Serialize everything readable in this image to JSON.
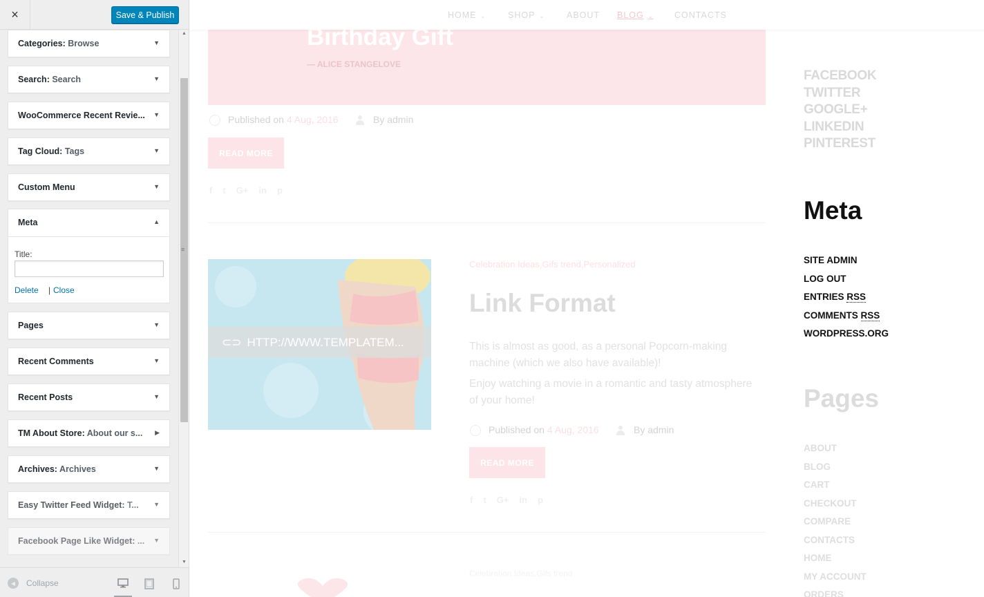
{
  "header": {
    "close_icon": "×",
    "publish_label": "Save & Publish"
  },
  "widgets": [
    {
      "title": "Categories:",
      "sub": " Browse"
    },
    {
      "title": "Search:",
      "sub": " Search"
    },
    {
      "title": "WooCommerce Recent Revie...",
      "sub": ""
    },
    {
      "title": "Tag Cloud:",
      "sub": " Tags"
    },
    {
      "title": "Custom Menu",
      "sub": ""
    },
    {
      "title": "Pages",
      "sub": ""
    },
    {
      "title": "Recent Comments",
      "sub": ""
    },
    {
      "title": "Recent Posts",
      "sub": ""
    },
    {
      "title": "TM About Store:",
      "sub": " About our s..."
    },
    {
      "title": "Archives:",
      "sub": " Archives"
    },
    {
      "title": "Easy Twitter Feed Widget:",
      "sub": " T..."
    },
    {
      "title": "Facebook Page Like Widget:",
      "sub": " ..."
    }
  ],
  "meta_widget": {
    "title": "Meta",
    "field_label": "Title:",
    "field_value": "",
    "delete_label": "Delete",
    "separator": "|",
    "close_label": "Close"
  },
  "footer": {
    "collapse_label": "Collapse"
  },
  "nav": {
    "items": [
      {
        "label": "HOME",
        "has_sub": true
      },
      {
        "label": "SHOP",
        "has_sub": true
      },
      {
        "label": "ABOUT",
        "has_sub": false
      },
      {
        "label": "BLOG",
        "has_sub": true
      },
      {
        "label": "CONTACTS",
        "has_sub": false
      }
    ],
    "active": "BLOG"
  },
  "post1": {
    "quote_title": "Birthday Gift",
    "quote_author": "— ALICE STANGELOVE",
    "published_prefix": "Published on ",
    "date": "4 Aug, 2016",
    "by": "By admin",
    "read_more": "READ MORE",
    "social": [
      "f",
      "t",
      "G+",
      "in",
      "p"
    ]
  },
  "post2": {
    "categories": "Celebration Ideas,Gifs trend,Personalized",
    "link_text": "HTTP://WWW.TEMPLATEM...",
    "title": "Link Format",
    "p1": "This is almost as good, as a personal Popcorn-making machine (which we also have available)!",
    "p2": "Enjoy watching a movie in a romantic and tasty atmosphere of your home!",
    "published_prefix": "Published on ",
    "date": "4 Aug, 2016",
    "by": "By admin",
    "read_more": "READ MORE",
    "social": [
      "f",
      "t",
      "G+",
      "in",
      "p"
    ]
  },
  "post3": {
    "categories": "Celebration Ideas,Gifs trend"
  },
  "right": {
    "social_links": [
      "FACEBOOK",
      "TWITTER",
      "GOOGLE+",
      "LINKEDIN",
      "PINTEREST"
    ],
    "meta_heading": "Meta",
    "meta_links": [
      {
        "text": "SITE ADMIN",
        "abbr": ""
      },
      {
        "text": "LOG OUT",
        "abbr": ""
      },
      {
        "text": "ENTRIES ",
        "abbr": "RSS"
      },
      {
        "text": "COMMENTS ",
        "abbr": "RSS"
      },
      {
        "text": "WORDPRESS.ORG",
        "abbr": ""
      }
    ],
    "pages_heading": "Pages",
    "pages_links": [
      "ABOUT",
      "BLOG",
      "CART",
      "CHECKOUT",
      "COMPARE",
      "CONTACTS",
      "HOME",
      "MY ACCOUNT",
      "ORDERS"
    ]
  },
  "colors": {
    "publish_blue": "#0085ba",
    "link_blue": "#0073aa",
    "accent_pink": "#fde4e8"
  }
}
